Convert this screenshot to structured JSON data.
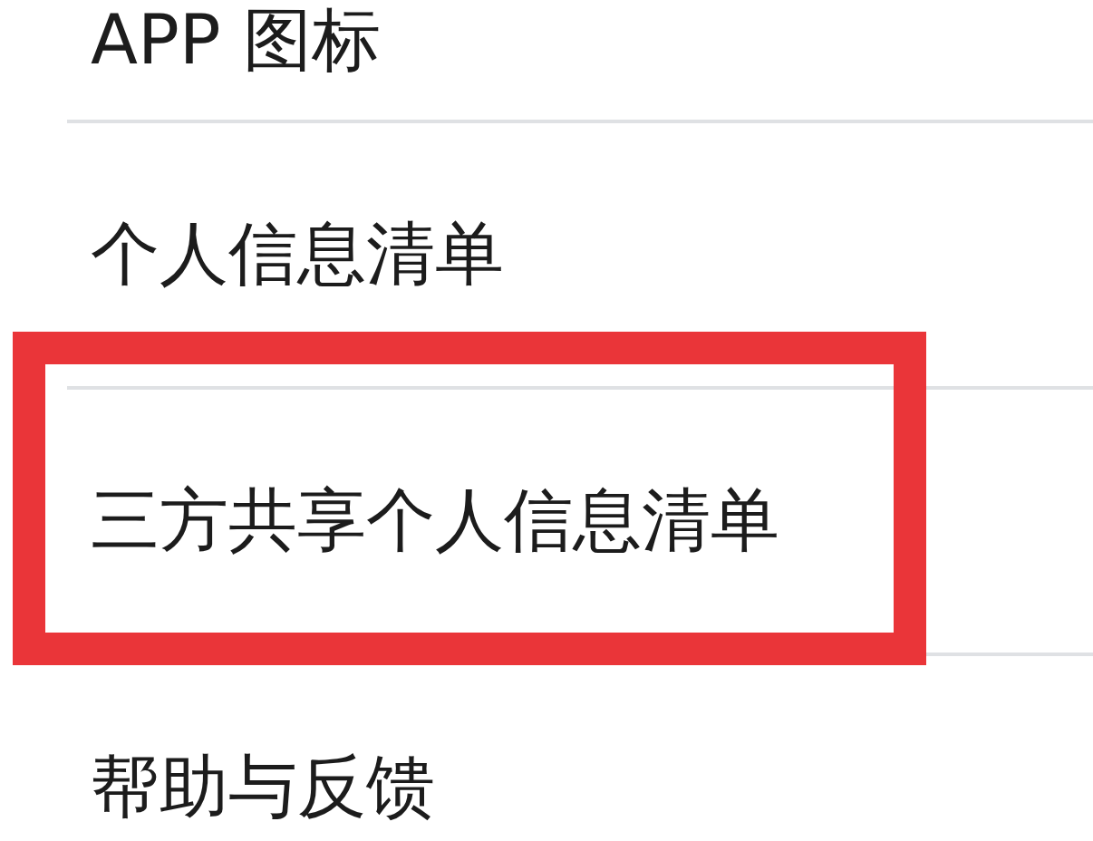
{
  "settings_items": [
    {
      "label": "APP 图标",
      "highlighted": false
    },
    {
      "label": "个人信息清单",
      "highlighted": false
    },
    {
      "label": "三方共享个人信息清单",
      "highlighted": true
    },
    {
      "label": "帮助与反馈",
      "highlighted": false
    }
  ]
}
